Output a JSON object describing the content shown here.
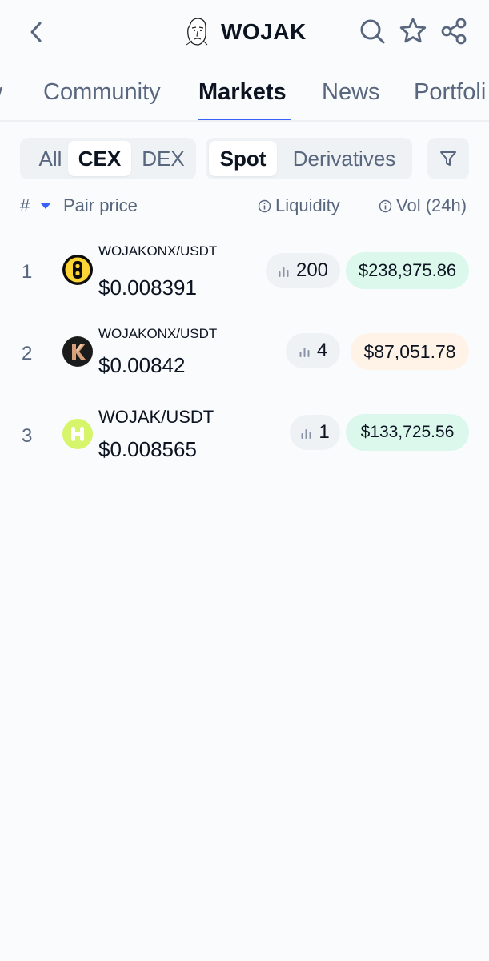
{
  "header": {
    "back_icon": "chevron-left-icon",
    "coin_logo": "wojak-face-icon",
    "title": "WOJAK",
    "icons": [
      "search-icon",
      "star-icon",
      "share-icon"
    ]
  },
  "tabs": [
    {
      "label": "w",
      "active": false
    },
    {
      "label": "Community",
      "active": false
    },
    {
      "label": "Markets",
      "active": true
    },
    {
      "label": "News",
      "active": false
    },
    {
      "label": "Portfoli",
      "active": false
    }
  ],
  "filters": {
    "exchange_type": {
      "options": [
        "All",
        "CEX",
        "DEX"
      ],
      "selected": "CEX"
    },
    "market_type": {
      "options": [
        "Spot",
        "Derivatives"
      ],
      "selected": "Spot"
    },
    "filter_icon": "filter-funnel-icon"
  },
  "columns": {
    "rank": "#",
    "pair_price": "Pair price",
    "liquidity": "Liquidity",
    "volume": "Vol (24h)"
  },
  "rows": [
    {
      "rank": "1",
      "pair": "WOJAKONX/USDT",
      "price": "$0.008391",
      "liquidity": "200",
      "volume": "$238,975.86",
      "volume_color": "#dcf8ec",
      "logo_bg": "#fcd535",
      "logo_icon": "exchange-bitunix-icon"
    },
    {
      "rank": "2",
      "pair": "WOJAKONX/USDT",
      "price": "$0.00842",
      "liquidity": "4",
      "volume": "$87,051.78",
      "volume_color": "#fef3e6",
      "logo_bg": "#1b1b1b",
      "logo_icon": "exchange-k-icon"
    },
    {
      "rank": "3",
      "pair": "WOJAK/USDT",
      "price": "$0.008565",
      "liquidity": "1",
      "volume": "$133,725.56",
      "volume_color": "#dcf8ec",
      "logo_bg": "#d6f56a",
      "logo_icon": "exchange-h-icon"
    }
  ],
  "colors": {
    "accent": "#3861fb",
    "text_primary": "#0c1421",
    "text_secondary": "#58667e",
    "chip_bg": "#eff2f5",
    "background": "#fafbfd"
  }
}
